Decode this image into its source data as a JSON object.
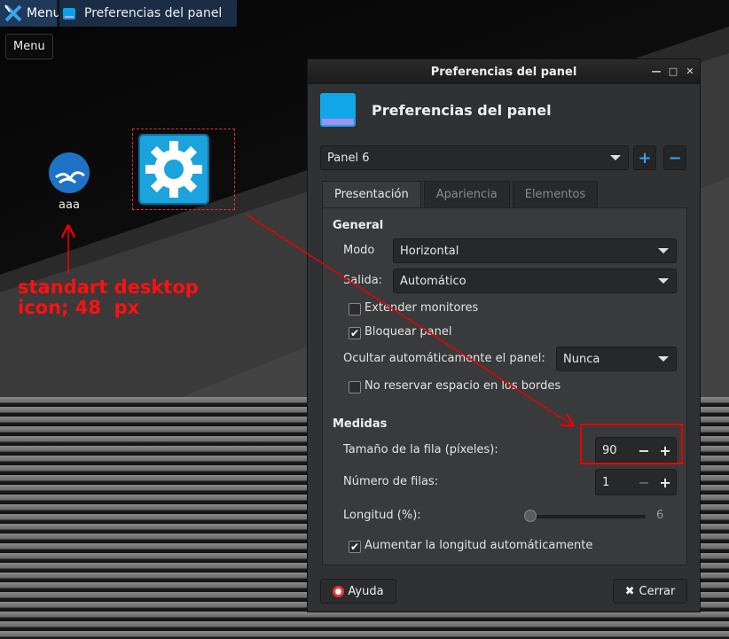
{
  "taskbar": {
    "menu_label": "Menu",
    "window_task_label": "Preferencias del panel",
    "tooltip": "Menu"
  },
  "desktop": {
    "icon_label": "aaa",
    "annotation": "standart desktop\nicon; 48  px",
    "annotation_color": "#ff1010"
  },
  "dialog": {
    "window_title": "Preferencias del panel",
    "header_title": "Preferencias del panel",
    "panel_select": "Panel 6",
    "add_button": "+",
    "remove_button": "−",
    "tabs": [
      "Presentación",
      "Apariencia",
      "Elementos"
    ],
    "active_tab": "Presentación",
    "general": {
      "heading": "General",
      "mode_label": "Modo",
      "mode_value": "Horizontal",
      "output_label": "Salida:",
      "output_value": "Automático",
      "extend_monitors": "Extender monitores",
      "extend_monitors_checked": false,
      "lock_panel": "Bloquear panel",
      "lock_panel_checked": true,
      "autohide_label": "Ocultar automáticamente el panel:",
      "autohide_value": "Nunca",
      "no_reserve": "No reservar espacio en los bordes",
      "no_reserve_checked": false
    },
    "measures": {
      "heading": "Medidas",
      "row_size_label": "Tamaño de la fila (píxeles):",
      "row_size_value": "90",
      "rows_label": "Número de filas:",
      "rows_value": "1",
      "length_label": "Longitud (%):",
      "length_value": "6",
      "auto_length": "Aumentar la longitud automáticamente",
      "auto_length_checked": true,
      "minus": "−",
      "plus": "+"
    },
    "help_button": "Ayuda",
    "close_button": "Cerrar"
  },
  "colors": {
    "accent": "#3aa0f0",
    "annotation_red": "#e00000",
    "app_icon": "#10a6e8"
  }
}
